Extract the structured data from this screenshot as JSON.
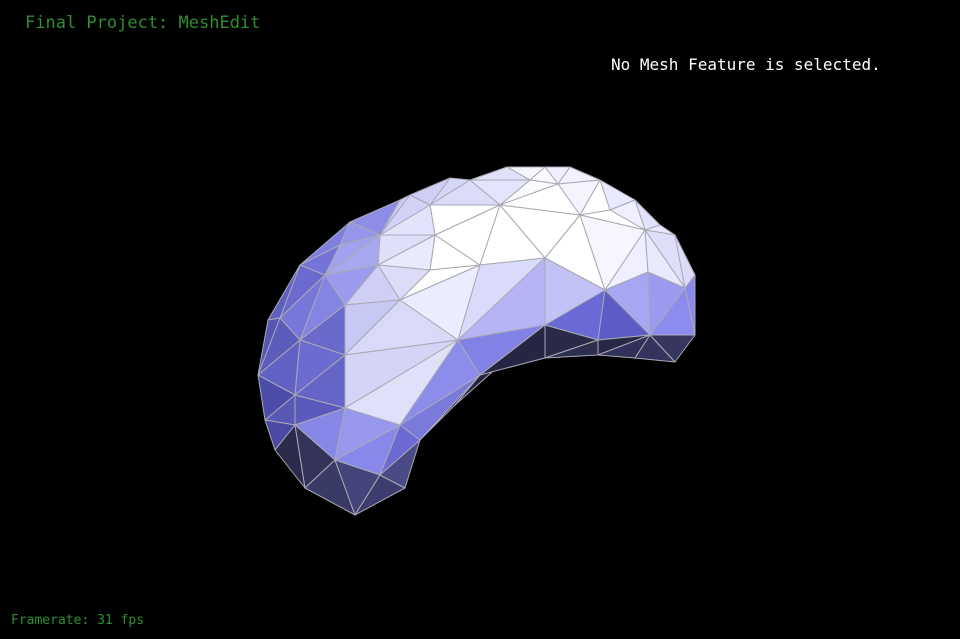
{
  "app": {
    "title": "Final Project: MeshEdit",
    "status_text": "No Mesh Feature is selected.",
    "framerate_text": "Framerate: 31 fps"
  },
  "viewport": {
    "background_color": "#000000",
    "mesh_edge_color": "#a9a9b5",
    "title_color": "#2f8f2f",
    "status_color": "#ffffff"
  }
}
